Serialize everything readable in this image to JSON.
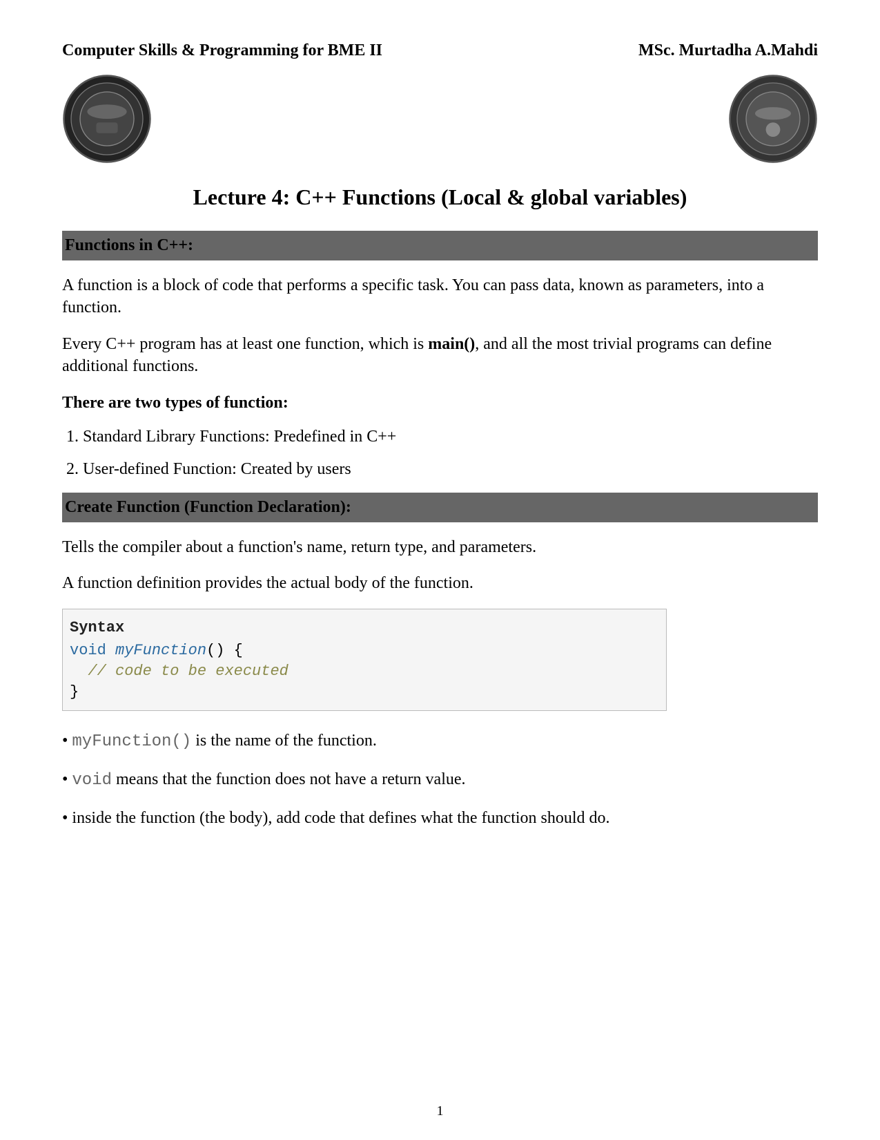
{
  "header": {
    "title": "Computer Skills & Programming for BME II",
    "author": "MSc. Murtadha A.Mahdi"
  },
  "lecture_title": "Lecture 4: C++ Functions (Local & global variables)",
  "section1": {
    "heading": "Functions in C++:",
    "para1": "A function is a block of code that performs a specific task. You can pass data, known as parameters, into a function.",
    "para2_pre": "Every C++ program has at least one function, which is ",
    "para2_bold": "main()",
    "para2_post": ", and all the most trivial programs can define additional functions.",
    "types_heading": "There are two types of function:",
    "type1": "1. Standard Library Functions: Predefined in C++",
    "type2": "2. User-defined Function: Created by users"
  },
  "section2": {
    "heading": "Create Function (Function Declaration):",
    "para1": "Tells the compiler about a function's name, return type, and parameters.",
    "para2": "A function definition provides the actual body of the function.",
    "syntax_label": "Syntax",
    "code": {
      "kw_void": "void",
      "fname": "myFunction",
      "parens_open": "() {",
      "comment": "// code to be executed",
      "close": "}"
    },
    "bullet1_code": "myFunction()",
    "bullet1_text": " is the name of the function.",
    "bullet2_code": "void",
    "bullet2_text": " means that the function does not have a return value.",
    "bullet3": "inside the function (the body), add code that defines what the function should do."
  },
  "page_number": "1"
}
